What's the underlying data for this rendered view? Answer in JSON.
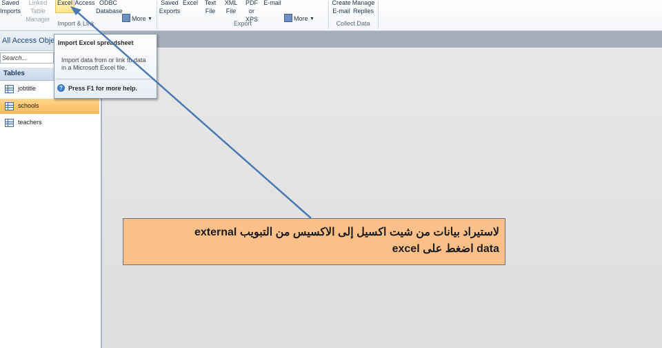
{
  "ribbon": {
    "import_link": [
      {
        "label": "Saved\nImports",
        "state": "normal"
      },
      {
        "label": "Linked Table\nManager",
        "state": "disabled"
      },
      {
        "label": "Excel",
        "state": "active"
      },
      {
        "label": "Access",
        "state": "normal"
      },
      {
        "label": "ODBC\nDatabase",
        "state": "normal"
      },
      {
        "label": "More",
        "icon": "more-icon"
      }
    ],
    "import_group_label": "Import & Link",
    "export": [
      {
        "label": "Saved\nExports"
      },
      {
        "label": "Excel"
      },
      {
        "label": "Text\nFile"
      },
      {
        "label": "XML\nFile"
      },
      {
        "label": "PDF\nor XPS"
      },
      {
        "label": "E-mail"
      },
      {
        "label": "More",
        "icon": "more-icon"
      }
    ],
    "export_group_label": "Export",
    "collect": [
      {
        "label": "Create\nE-mail"
      },
      {
        "label": "Manage\nReplies"
      }
    ],
    "collect_group_label": "Collect Data"
  },
  "nav": {
    "title": "All Access Objects",
    "search_value": "Search...",
    "category": "Tables",
    "items": [
      {
        "label": "jobtitle",
        "icon": "table-icon",
        "selected": false
      },
      {
        "label": "schools",
        "icon": "table-icon",
        "selected": true
      },
      {
        "label": "teachers",
        "icon": "table-icon",
        "selected": false
      }
    ]
  },
  "tooltip": {
    "title": "Import Excel spreadsheet",
    "body": "Import data from or link to data in a Microsoft Excel file.",
    "help": "Press F1 for more help.",
    "help_icon": "help-icon"
  },
  "annotation": {
    "text": "لاستيراد بيانات من شيت اكسيل إلى الاكسيس من التبويب  external\ndata اضغط على excel",
    "background": "#fcc088",
    "arrow_color": "#5b86b8"
  }
}
